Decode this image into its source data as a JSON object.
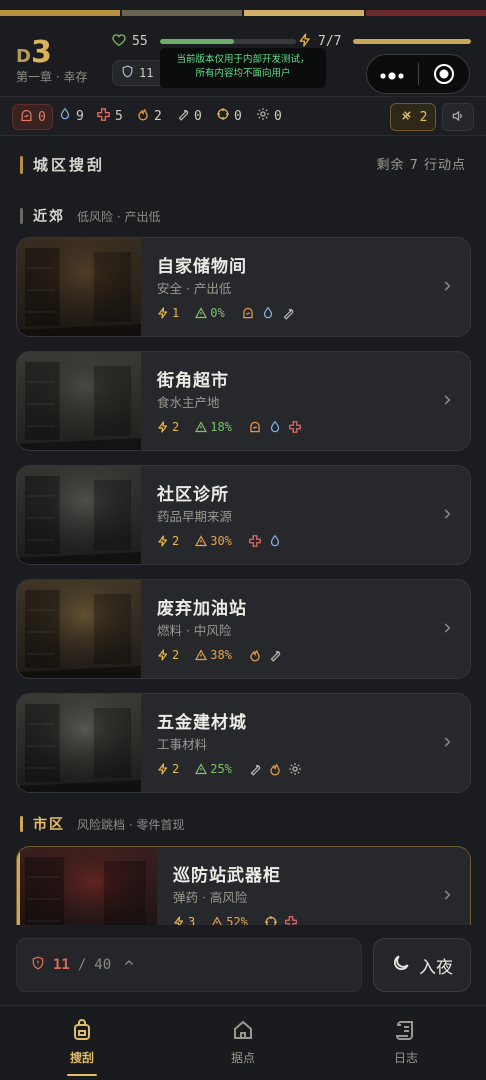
{
  "stripe_colors": [
    "#b8913f",
    "#6a6352",
    "#d2b06a",
    "#6d2a2a"
  ],
  "header": {
    "day_prefix": "D",
    "day_number": "3",
    "chapter": "第一章 · 幸存",
    "hp_value": "55",
    "hp_fraction": 0.55,
    "energy_value": "7/7",
    "energy_fraction": 1.0,
    "shield_value": "11",
    "notice_line1": "当前版本仅用于内部开发测试，",
    "notice_line2": "所有内容均不面向用户"
  },
  "resources": [
    {
      "icon": "bread-icon",
      "value": "0",
      "color": "#e27b66"
    },
    {
      "icon": "water-drop-icon",
      "value": "9",
      "color": "#7fb2e0"
    },
    {
      "icon": "medical-cross-icon",
      "value": "5",
      "color": "#e06a66"
    },
    {
      "icon": "fire-icon",
      "value": "2",
      "color": "#e29a4a"
    },
    {
      "icon": "wrench-icon",
      "value": "0",
      "color": "#b6b3ad"
    },
    {
      "icon": "crosshair-icon",
      "value": "0",
      "color": "#d9b45a"
    },
    {
      "icon": "gear-icon",
      "value": "0",
      "color": "#b6b3ad"
    }
  ],
  "heal_count": "2",
  "scavenge": {
    "title": "城区搜刮",
    "remaining": "剩余 7 行动点"
  },
  "sections": {
    "suburb": {
      "title": "近郊",
      "sub": "低风险 · 产出低"
    },
    "city": {
      "title": "市区",
      "sub": "风险跳档 · 零件首现"
    }
  },
  "locations": [
    {
      "name": "自家储物间",
      "desc": "安全 · 产出低",
      "energy": "1",
      "risk": "0%",
      "risk_level": "low",
      "loot": [
        "bread-icon",
        "water-drop-icon",
        "wrench-icon"
      ]
    },
    {
      "name": "街角超市",
      "desc": "食水主产地",
      "energy": "2",
      "risk": "18%",
      "risk_level": "low",
      "loot": [
        "bread-icon",
        "water-drop-icon",
        "medical-cross-icon"
      ]
    },
    {
      "name": "社区诊所",
      "desc": "药品早期来源",
      "energy": "2",
      "risk": "30%",
      "risk_level": "mid",
      "loot": [
        "medical-cross-icon",
        "water-drop-icon"
      ]
    },
    {
      "name": "废弃加油站",
      "desc": "燃料 · 中风险",
      "energy": "2",
      "risk": "38%",
      "risk_level": "mid",
      "loot": [
        "fire-icon",
        "wrench-icon"
      ]
    },
    {
      "name": "五金建材城",
      "desc": "工事材料",
      "energy": "2",
      "risk": "25%",
      "risk_level": "low",
      "loot": [
        "wrench-icon",
        "fire-icon",
        "gear-icon"
      ]
    },
    {
      "name": "巡防站武器柜",
      "desc": "弹药 · 高风险",
      "energy": "3",
      "risk": "52%",
      "risk_level": "mid",
      "loot": [
        "crosshair-icon",
        "medical-cross-icon"
      ]
    }
  ],
  "bag": {
    "current": "11",
    "sep": "/",
    "max": "40"
  },
  "night_button": "入夜",
  "tabs": [
    {
      "label": "搜刮",
      "icon": "backpack-icon",
      "active": true
    },
    {
      "label": "据点",
      "icon": "home-icon",
      "active": false
    },
    {
      "label": "日志",
      "icon": "scroll-icon",
      "active": false
    }
  ],
  "colors": {
    "accent": "#e0bd68",
    "energy": "#e7b64a",
    "risk_low": "#7fbf6a",
    "risk_mid": "#e7a24a",
    "hp_bar": "#6fae6b",
    "energy_bar": "#c9a85a"
  }
}
